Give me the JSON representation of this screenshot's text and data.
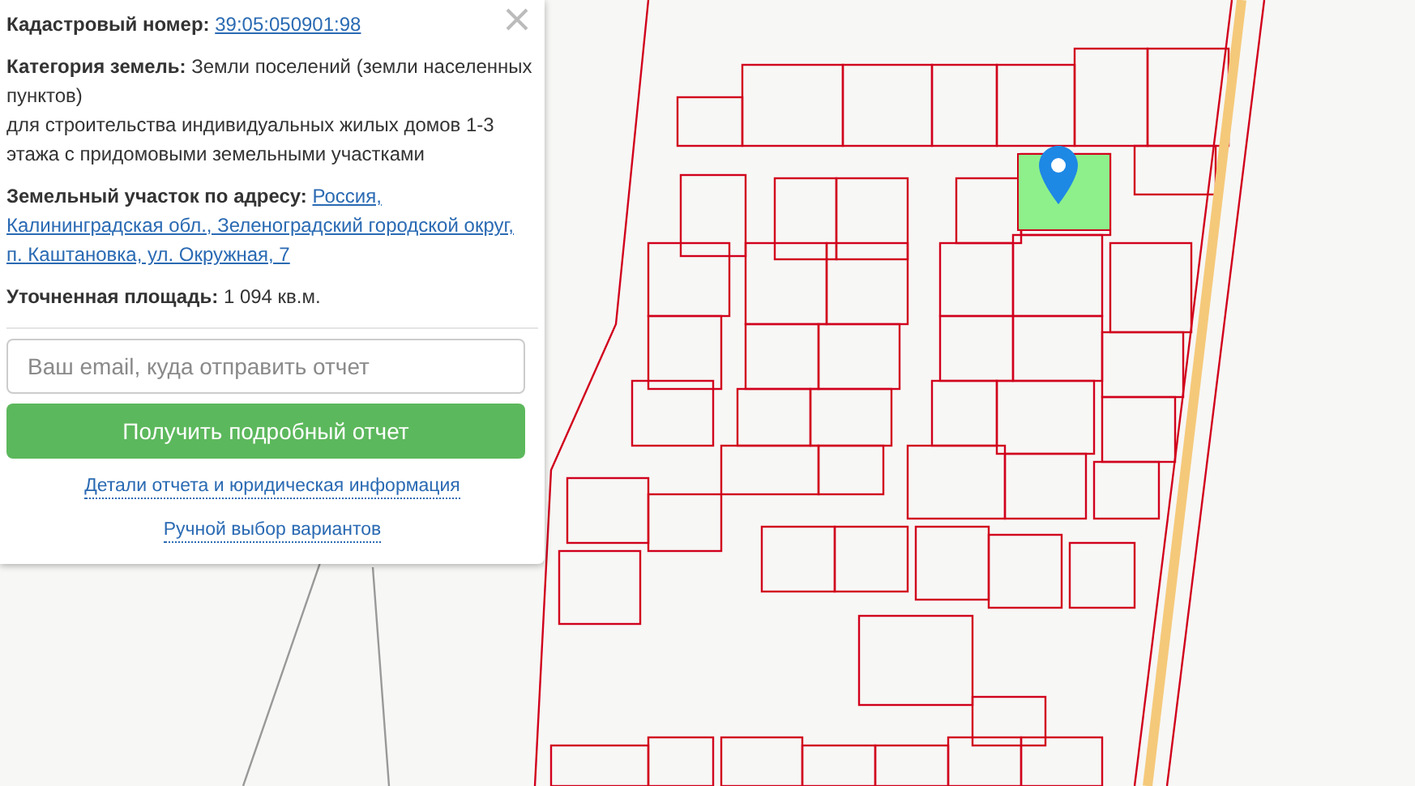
{
  "popup": {
    "fields": [
      {
        "label": "Кадастровый номер:",
        "value": "39:05:050901:98",
        "kind": "link"
      },
      {
        "label": "Категория земель:",
        "value": "Земли поселений (земли населенных пунктов)",
        "extra": "для строительства индивидуальных жилых домов 1-3 этажа с придомовыми земельными участками",
        "kind": "text"
      },
      {
        "label": "Земельный участок по адресу:",
        "value_lines": [
          "Россия,",
          "Калининградская обл., Зеленоградский городской округ,",
          "п. Каштановка, ул. Окружная, 7"
        ],
        "kind": "link_lines"
      },
      {
        "label": "Уточненная площадь:",
        "value": "1 094 кв.м.",
        "kind": "text"
      }
    ],
    "email": {
      "placeholder": "Ваш email, куда отправить отчет"
    },
    "submit": "Получить подробный отчет",
    "links": [
      "Детали отчета и юридическая информация",
      "Ручной выбор вариантов"
    ]
  }
}
